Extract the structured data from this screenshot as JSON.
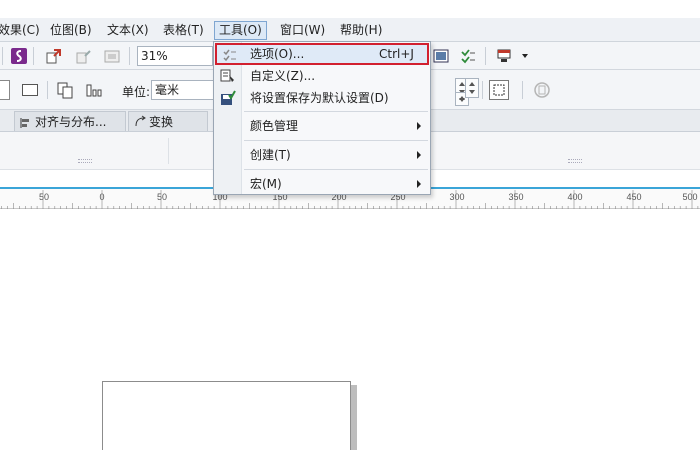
{
  "menubar": {
    "items": [
      {
        "label": "效果(C)"
      },
      {
        "label": "位图(B)"
      },
      {
        "label": "文本(X)"
      },
      {
        "label": "表格(T)"
      },
      {
        "label": "工具(O)"
      },
      {
        "label": "窗口(W)"
      },
      {
        "label": "帮助(H)"
      }
    ]
  },
  "toolbar": {
    "zoom": "31%"
  },
  "propertybar": {
    "unit_label": "单位:",
    "unit_value": "毫米"
  },
  "dock_tabs": [
    {
      "label": "对齐与分布..."
    },
    {
      "label": "变换"
    }
  ],
  "ruler": {
    "labels": [
      "50",
      "0",
      "50",
      "100",
      "150",
      "200",
      "250",
      "300",
      "350",
      "400",
      "450",
      "500"
    ]
  },
  "tools_menu": {
    "items": [
      {
        "label": "选项(O)...",
        "shortcut": "Ctrl+J",
        "icon": "options-icon"
      },
      {
        "label": "自定义(Z)...",
        "icon": "customize-icon"
      },
      {
        "label": "将设置保存为默认设置(D)",
        "icon": "save-defaults-icon"
      },
      {
        "label": "颜色管理",
        "submenu": true
      },
      {
        "label": "创建(T)",
        "submenu": true
      },
      {
        "label": "宏(M)",
        "submenu": true
      }
    ]
  },
  "colors": {
    "accent_blue": "#3aa5d8",
    "highlight_red": "#d2202f",
    "menu_bg": "#f7f8fa"
  }
}
